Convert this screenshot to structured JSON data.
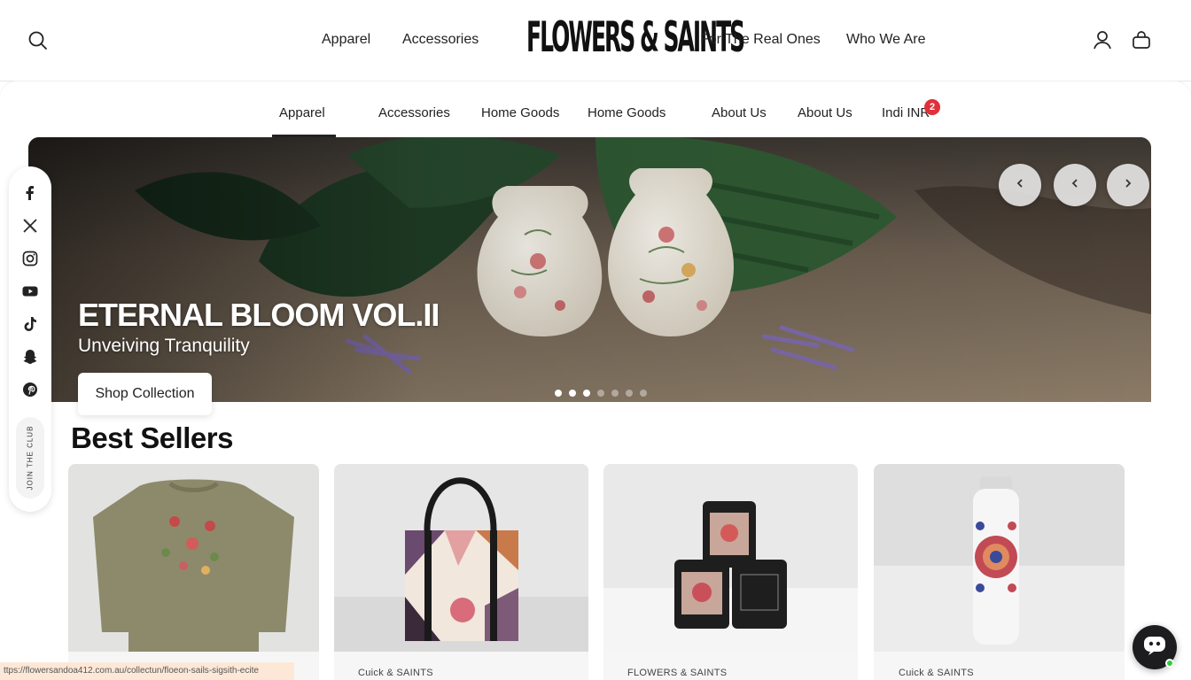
{
  "header": {
    "logo_text": "FLOWERS & SAINTS",
    "nav_left": [
      "Apparel",
      "Accessories"
    ],
    "nav_right": [
      "For The Real Ones",
      "Who We Are"
    ]
  },
  "sub_nav": {
    "items": [
      "Apparel",
      "Accessories",
      "Home Goods",
      "Home Goods",
      "About Us",
      "About Us",
      "Indi INR"
    ],
    "active": "Apparel",
    "badge_count": "2"
  },
  "hero": {
    "title": "ETERNAL BLOOM VOL.II",
    "subtitle": "Unveiving Tranquility",
    "cta": "Shop Collection",
    "slide_count": 7,
    "active_slide": 0
  },
  "social": {
    "icons": [
      "facebook-icon",
      "x-icon",
      "instagram-icon",
      "youtube-icon",
      "tiktok-icon",
      "snapchat-icon",
      "pinterest-icon"
    ],
    "join_label": "JOIN THE CLUB"
  },
  "best_sellers": {
    "title": "Best Sellers",
    "products": [
      {
        "brand": "Cuick & SAINTS",
        "image": "embroidered-sweatshirt"
      },
      {
        "brand": "Cuick & SAINTS",
        "image": "patchwork-tote-bag"
      },
      {
        "brand": "FLOWERS & SAINTS",
        "image": "floral-candles"
      },
      {
        "brand": "Cuick & SAINTS",
        "image": "floral-water-bottle"
      }
    ]
  },
  "status_url": "ttps://flowersandoa412.com.au/collectun/floeon-sails-sigsith-ecite",
  "colors": {
    "accent_badge": "#e0303a",
    "text": "#1a1a1a",
    "chat_bg": "#1d1d1f",
    "online": "#2ecc40"
  }
}
